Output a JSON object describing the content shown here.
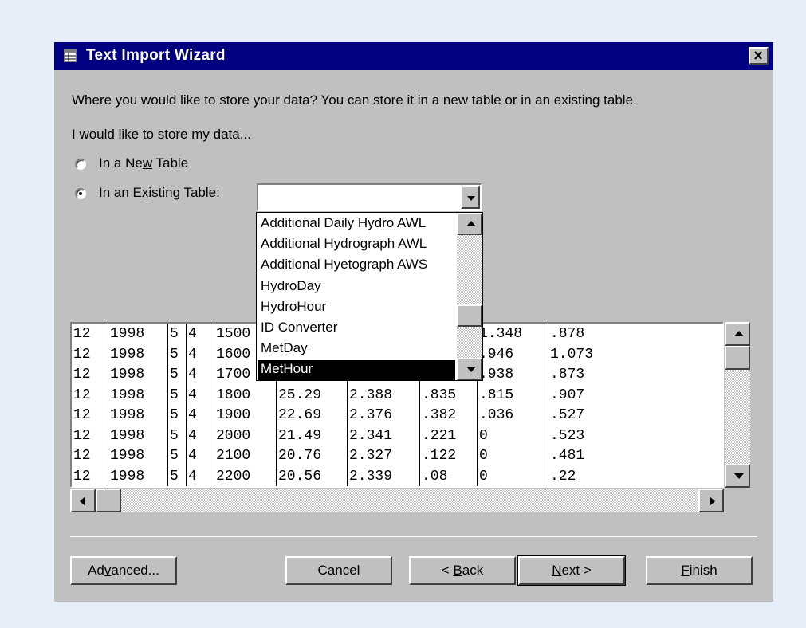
{
  "window": {
    "title": "Text Import Wizard",
    "close_glyph": "×"
  },
  "prompt": {
    "question": "Where you would like to store your data?  You can store it in a new table or in an existing table.",
    "subtitle": "I would like to store my data..."
  },
  "options": {
    "new_table": {
      "prefix": "In a Ne",
      "mnemonic": "w",
      "suffix": " Table",
      "selected": false
    },
    "existing_table": {
      "prefix": "In an E",
      "mnemonic": "x",
      "suffix": "isting Table:",
      "selected": true
    }
  },
  "table_combo": {
    "value": "",
    "items": [
      "Additional Daily Hydro AWL",
      "Additional Hydrograph AWL",
      "Additional Hyetograph AWS",
      "HydroDay",
      "HydroHour",
      "ID Converter",
      "MetDay",
      "MetHour"
    ],
    "selected_index": 7
  },
  "preview": {
    "rows": [
      [
        "12",
        "1998",
        "5",
        "4",
        "1500",
        "",
        "",
        "",
        "1.348",
        ".878"
      ],
      [
        "12",
        "1998",
        "5",
        "4",
        "1600",
        "",
        "",
        "",
        ".946",
        "1.073"
      ],
      [
        "12",
        "1998",
        "5",
        "4",
        "1700",
        "",
        "",
        "",
        ".938",
        ".873"
      ],
      [
        "12",
        "1998",
        "5",
        "4",
        "1800",
        "25.29",
        "2.388",
        ".835",
        ".815",
        ".907"
      ],
      [
        "12",
        "1998",
        "5",
        "4",
        "1900",
        "22.69",
        "2.376",
        ".382",
        ".036",
        ".527"
      ],
      [
        "12",
        "1998",
        "5",
        "4",
        "2000",
        "21.49",
        "2.341",
        ".221",
        "0",
        ".523"
      ],
      [
        "12",
        "1998",
        "5",
        "4",
        "2100",
        "20.76",
        "2.327",
        ".122",
        "0",
        ".481"
      ],
      [
        "12",
        "1998",
        "5",
        "4",
        "2200",
        "20.56",
        "2.339",
        ".08",
        "0",
        ".22"
      ]
    ]
  },
  "buttons": {
    "advanced": {
      "prefix": "Ad",
      "mnemonic": "v",
      "suffix": "anced..."
    },
    "cancel": {
      "label": "Cancel"
    },
    "back": {
      "prefix": "< ",
      "mnemonic": "B",
      "suffix": "ack"
    },
    "next": {
      "prefix": "",
      "mnemonic": "N",
      "suffix": "ext >"
    },
    "finish": {
      "prefix": "",
      "mnemonic": "F",
      "suffix": "inish"
    }
  },
  "colors": {
    "window_bg": "#c0c0c0",
    "titlebar": "#000080",
    "page_bg": "#e8eef8",
    "selection": "#000000"
  },
  "icons": [
    "table-icon",
    "close-icon",
    "dropdown-arrow-icon",
    "scroll-up-arrow-icon",
    "scroll-down-arrow-icon",
    "scroll-left-arrow-icon",
    "scroll-right-arrow-icon"
  ]
}
